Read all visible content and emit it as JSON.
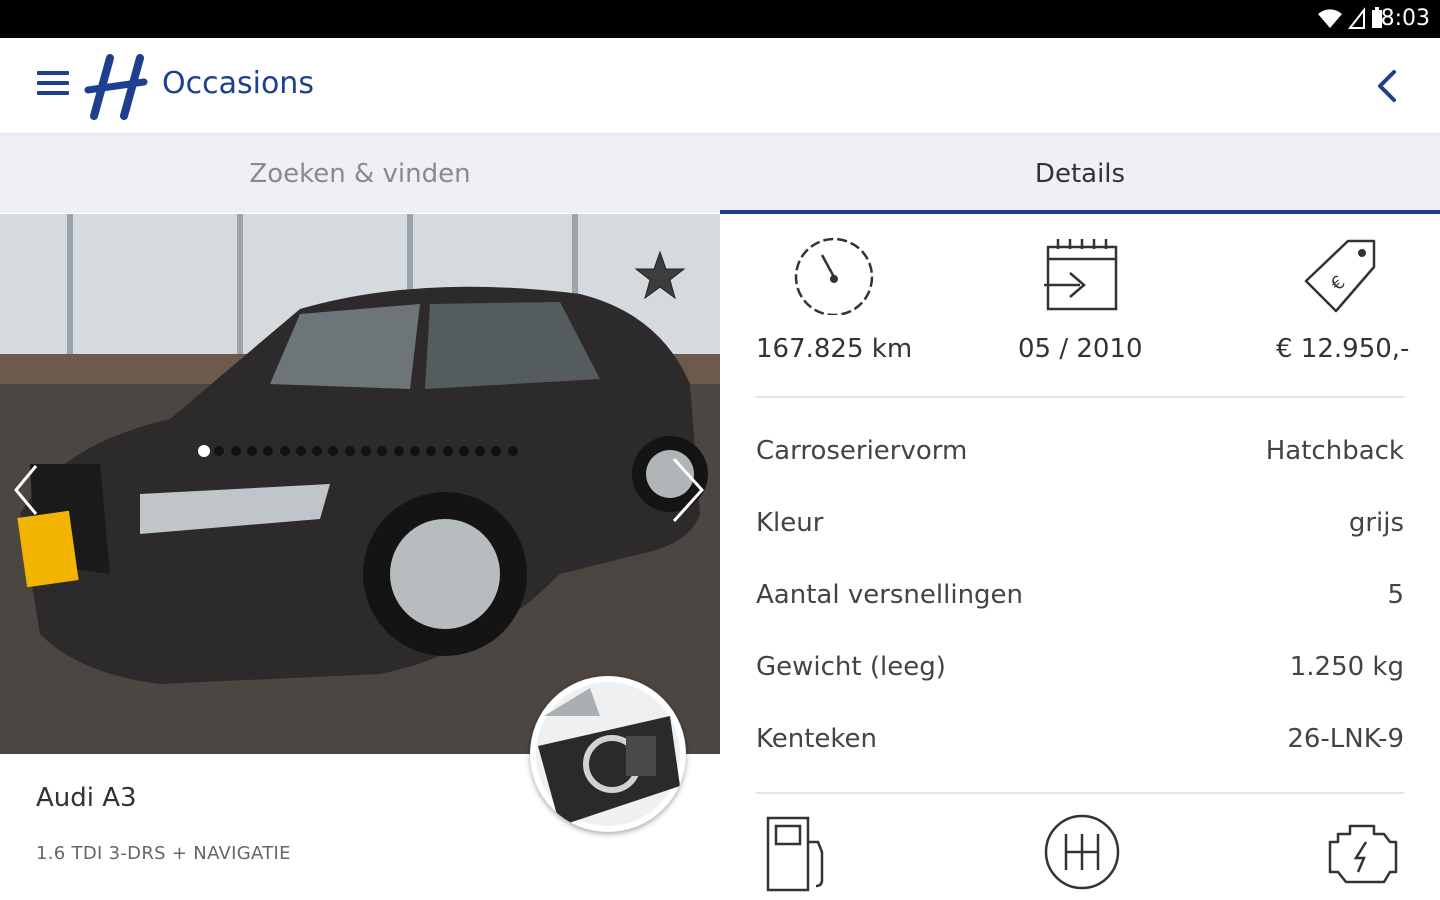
{
  "status_bar": {
    "time": "8:03"
  },
  "app_bar": {
    "title": "Occasions"
  },
  "tabs": [
    {
      "label": "Zoeken & vinden",
      "selected": false
    },
    {
      "label": "Details",
      "selected": true
    }
  ],
  "gallery": {
    "photo_count": 20,
    "current_index": 0
  },
  "car": {
    "name": "Audi A3",
    "variant": "1.6 TDI 3-DRS + NAVIGATIE"
  },
  "stats": {
    "mileage": "167.825 km",
    "date": "05 / 2010",
    "price": "€ 12.950,-"
  },
  "specs": [
    {
      "label": "Carroseriervorm",
      "value": "Hatchback"
    },
    {
      "label": "Kleur",
      "value": "grijs"
    },
    {
      "label": "Aantal versnellingen",
      "value": "5"
    },
    {
      "label": "Gewicht (leeg)",
      "value": "1.250 kg"
    },
    {
      "label": "Kenteken",
      "value": "26-LNK-9"
    }
  ],
  "icons": {
    "menu": "menu-icon",
    "back": "chevron-left-icon",
    "favorite": "star-icon",
    "mileage": "speedometer-icon",
    "date": "calendar-icon",
    "price": "price-tag-icon",
    "fuel": "fuel-pump-icon",
    "gearbox": "gear-shift-icon",
    "engine": "engine-icon"
  },
  "colors": {
    "brand": "#1e3f8f",
    "tab_bar": "#eef0f3"
  }
}
